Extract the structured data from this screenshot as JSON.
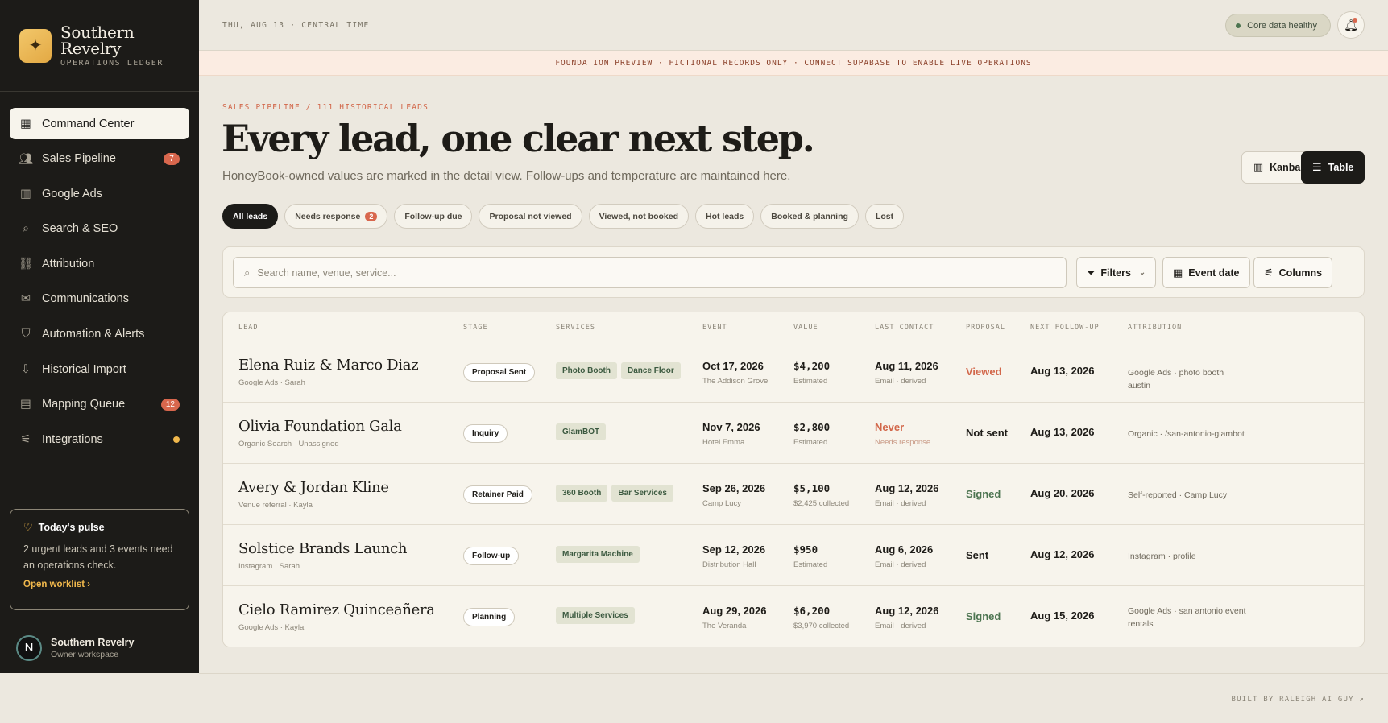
{
  "brand": {
    "name_line1": "Southern",
    "name_line2": "Revelry",
    "subtitle": "OPERATIONS LEDGER"
  },
  "nav": [
    {
      "label": "Command Center",
      "icon": "grid-icon",
      "active": true
    },
    {
      "label": "Sales Pipeline",
      "icon": "users-icon",
      "badge": "7"
    },
    {
      "label": "Google Ads",
      "icon": "bar-chart-icon"
    },
    {
      "label": "Search & SEO",
      "icon": "search-icon"
    },
    {
      "label": "Attribution",
      "icon": "link-icon"
    },
    {
      "label": "Communications",
      "icon": "mail-icon"
    },
    {
      "label": "Automation & Alerts",
      "icon": "shield-icon"
    },
    {
      "label": "Historical Import",
      "icon": "import-icon"
    },
    {
      "label": "Mapping Queue",
      "icon": "map-icon",
      "badge": "12"
    },
    {
      "label": "Integrations",
      "icon": "sliders-icon",
      "dot": true
    }
  ],
  "pulse": {
    "title": "Today's pulse",
    "text": "2 urgent leads and 3 events need an operations check.",
    "link": "Open worklist"
  },
  "owner": {
    "initial": "N",
    "name": "Southern Revelry",
    "sub": "Owner workspace"
  },
  "topbar": {
    "date": "THU, AUG 13 · CENTRAL TIME",
    "health": "Core data healthy"
  },
  "banner": "FOUNDATION PREVIEW · FICTIONAL RECORDS ONLY · CONNECT SUPABASE TO ENABLE LIVE OPERATIONS",
  "page": {
    "crumb": "SALES PIPELINE / 111 HISTORICAL LEADS",
    "title": "Every lead, one clear next step.",
    "subtitle": "HoneyBook-owned values are marked in the detail view. Follow-ups and temperature are maintained here.",
    "kanban": "Kanban",
    "table": "Table"
  },
  "chips": [
    {
      "label": "All leads",
      "active": true
    },
    {
      "label": "Needs response",
      "count": "2"
    },
    {
      "label": "Follow-up due"
    },
    {
      "label": "Proposal not viewed"
    },
    {
      "label": "Viewed, not booked"
    },
    {
      "label": "Hot leads"
    },
    {
      "label": "Booked & planning"
    },
    {
      "label": "Lost"
    }
  ],
  "filters": {
    "search_placeholder": "Search name, venue, service...",
    "filters": "Filters",
    "event_date": "Event date",
    "columns": "Columns"
  },
  "columns": [
    "LEAD",
    "STAGE",
    "SERVICES",
    "EVENT",
    "VALUE",
    "LAST CONTACT",
    "PROPOSAL",
    "NEXT FOLLOW-UP",
    "ATTRIBUTION"
  ],
  "rows": [
    {
      "name": "Elena Ruiz & Marco Diaz",
      "source": "Google Ads · Sarah",
      "stage": "Proposal Sent",
      "services": [
        "Photo Booth",
        "Dance Floor"
      ],
      "event_date": "Oct 17, 2026",
      "venue": "The Addison Grove",
      "value": "$4,200",
      "value_note": "Estimated",
      "last_contact": "Aug 11, 2026",
      "contact_note": "Email · derived",
      "proposal": "Viewed",
      "proposal_color": "#d2674a",
      "followup": "Aug 13, 2026",
      "attribution": "Google Ads · photo booth austin"
    },
    {
      "name": "Olivia Foundation Gala",
      "source": "Organic Search · Unassigned",
      "stage": "Inquiry",
      "services": [
        "GlamBOT"
      ],
      "event_date": "Nov 7, 2026",
      "venue": "Hotel Emma",
      "value": "$2,800",
      "value_note": "Estimated",
      "last_contact": "Never",
      "contact_color": "#d2674a",
      "contact_note": "Needs response",
      "proposal": "Not sent",
      "proposal_color": "#1e1c18",
      "followup": "Aug 13, 2026",
      "attribution": "Organic · /san-antonio-glambot"
    },
    {
      "name": "Avery & Jordan Kline",
      "source": "Venue referral · Kayla",
      "stage": "Retainer Paid",
      "services": [
        "360 Booth",
        "Bar Services"
      ],
      "event_date": "Sep 26, 2026",
      "venue": "Camp Lucy",
      "value": "$5,100",
      "value_note": "$2,425 collected",
      "last_contact": "Aug 12, 2026",
      "contact_note": "Email · derived",
      "proposal": "Signed",
      "proposal_color": "#4c7450",
      "followup": "Aug 20, 2026",
      "attribution": "Self-reported · Camp Lucy"
    },
    {
      "name": "Solstice Brands Launch",
      "source": "Instagram · Sarah",
      "stage": "Follow-up",
      "services": [
        "Margarita Machine"
      ],
      "event_date": "Sep 12, 2026",
      "venue": "Distribution Hall",
      "value": "$950",
      "value_note": "Estimated",
      "last_contact": "Aug 6, 2026",
      "contact_note": "Email · derived",
      "proposal": "Sent",
      "proposal_color": "#1e1c18",
      "followup": "Aug 12, 2026",
      "attribution": "Instagram · profile"
    },
    {
      "name": "Cielo Ramirez Quinceañera",
      "source": "Google Ads · Kayla",
      "stage": "Planning",
      "services": [
        "Multiple Services"
      ],
      "event_date": "Aug 29, 2026",
      "venue": "The Veranda",
      "value": "$6,200",
      "value_note": "$3,970 collected",
      "last_contact": "Aug 12, 2026",
      "contact_note": "Email · derived",
      "proposal": "Signed",
      "proposal_color": "#4c7450",
      "followup": "Aug 15, 2026",
      "attribution": "Google Ads · san antonio event rentals"
    }
  ],
  "footer": "BUILT BY RALEIGH AI GUY ↗"
}
